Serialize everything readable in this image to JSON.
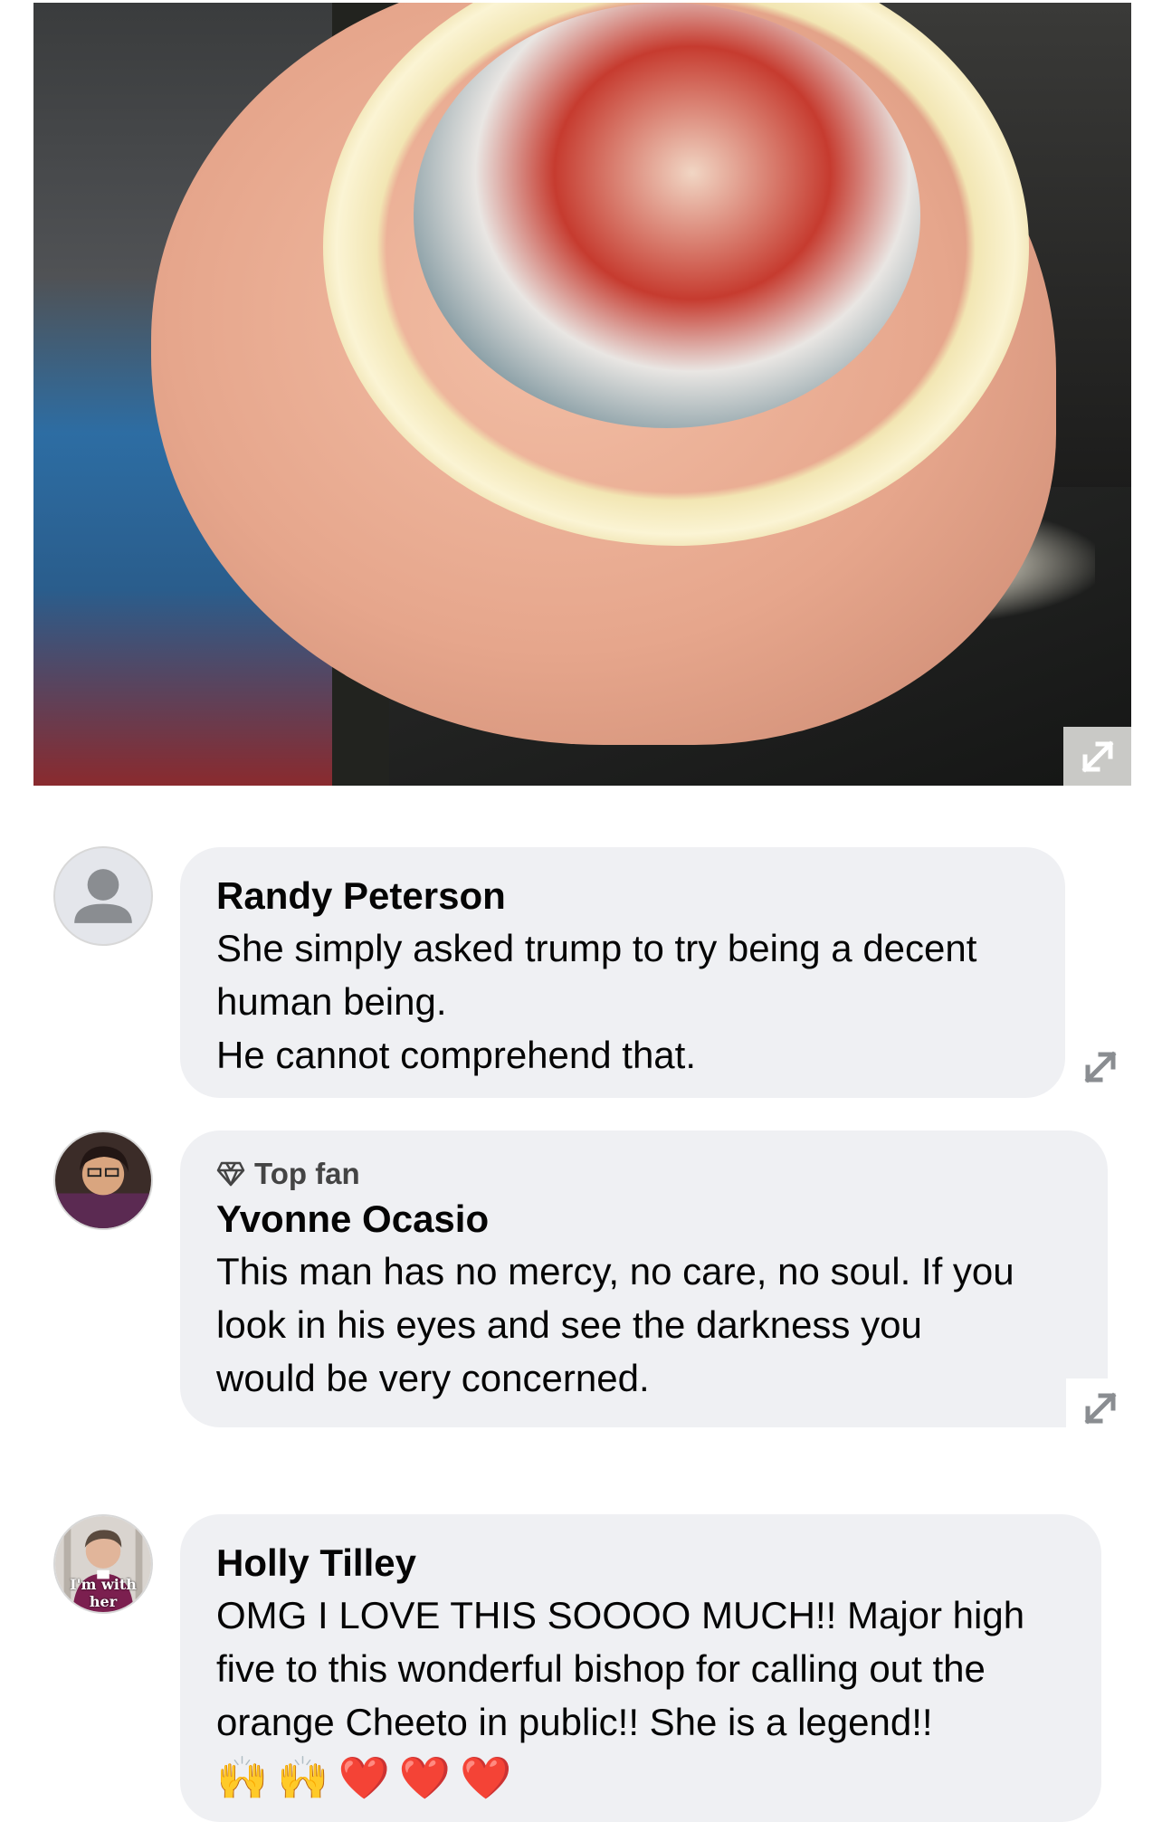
{
  "post_image": {
    "expand_icon": "expand-arrows-icon"
  },
  "comments": [
    {
      "author": "Randy Peterson",
      "text": "She simply asked trump to try being a decent\nhuman being.\nHe cannot comprehend that.",
      "avatar": "default-avatar-icon"
    },
    {
      "badge": "Top fan",
      "badge_icon": "diamond-icon",
      "author": "Yvonne Ocasio",
      "text": "This man has no mercy, no care, no soul. If you\nlook in his eyes and see the darkness you\nwould be very concerned."
    },
    {
      "author": "Holly Tilley",
      "text": "OMG I LOVE THIS SOOOO MUCH!! Major high\nfive to this wonderful bishop for calling out the\norange Cheeto in public!! She is a legend!!",
      "avatar_text": "I'm with her",
      "emojis": [
        "🙌",
        "🙌",
        "❤️",
        "❤️",
        "❤️"
      ]
    }
  ]
}
